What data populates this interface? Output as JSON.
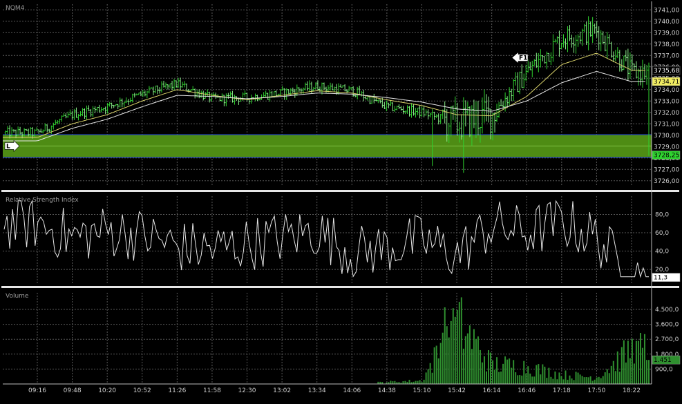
{
  "instrument": "NQM4",
  "price_pane": {
    "ylim": [
      3725.5,
      3741.5
    ],
    "y_ticks": [
      "3741,00",
      "3740,00",
      "3739,00",
      "3738,00",
      "3737,00",
      "3736,00",
      "3735,00",
      "3734,00",
      "3733,00",
      "3732,00",
      "3731,00",
      "3730,00",
      "3729,00",
      "3728,00",
      "3727,00",
      "3726,00"
    ],
    "zone": {
      "low": 3728.05,
      "high": 3730.05,
      "color": "#4e8c14"
    },
    "ma_fast_last": "3735,68",
    "ma_slow_last": "3734,71",
    "last_price": "3728,25",
    "markers": [
      {
        "label": "L",
        "side": "long"
      },
      {
        "label": "F1",
        "side": "short"
      }
    ]
  },
  "rsi_pane": {
    "title": "Relative Strength Index",
    "ylim": [
      5,
      100
    ],
    "y_ticks": [
      "80,0",
      "60,0",
      "40,0",
      "20,0"
    ],
    "last": "11,3"
  },
  "volume_pane": {
    "title": "Volume",
    "ylim": [
      0,
      5500
    ],
    "y_ticks": [
      "4.500,0",
      "3.600,0",
      "2.700,0",
      "1.800,0",
      "900,0"
    ],
    "last": "1.451"
  },
  "x_ticks": [
    "09:16",
    "09:48",
    "10:20",
    "10:52",
    "11:26",
    "11:58",
    "12:30",
    "13:02",
    "13:34",
    "14:06",
    "14:38",
    "15:10",
    "15:42",
    "16:14",
    "16:46",
    "17:18",
    "17:50",
    "18:22"
  ],
  "colors": {
    "bar": "#2fd22f",
    "bar_light": "#8ef08e",
    "ma_fast": "#d9d26a",
    "ma_slow": "#e8e8e8",
    "grid": "#5a5a5a",
    "volume": "#2f8f2f",
    "zone": "#4e8c14",
    "zone_border": "#1f3fbf"
  },
  "chart_data": [
    {
      "type": "bar",
      "title": "NQM4",
      "ylim": [
        3725.5,
        3741.5
      ],
      "x": [
        "09:16",
        "09:48",
        "10:20",
        "10:52",
        "11:26",
        "11:58",
        "12:30",
        "13:02",
        "13:34",
        "14:06",
        "14:38",
        "15:10",
        "15:42",
        "16:14",
        "16:46",
        "17:18",
        "17:50",
        "18:22"
      ],
      "series": [
        {
          "values": [
            3730.2,
            3731.8,
            3732.5,
            3733.6,
            3734.5,
            3733.2,
            3733.3,
            3733.7,
            3734.3,
            3733.9,
            3732.5,
            3732.0,
            3731.0,
            3731.8,
            3735.5,
            3738.5,
            3739.2,
            3735.5
          ]
        },
        {
          "values": [
            3729.8,
            3731.0,
            3731.8,
            3733.0,
            3734.0,
            3733.5,
            3733.1,
            3733.5,
            3733.9,
            3733.7,
            3733.1,
            3732.6,
            3731.8,
            3731.7,
            3733.4,
            3736.2,
            3737.2,
            3735.7
          ]
        },
        {
          "values": [
            3729.5,
            3730.6,
            3731.4,
            3732.5,
            3733.5,
            3733.4,
            3733.2,
            3733.4,
            3733.7,
            3733.6,
            3733.3,
            3732.9,
            3732.3,
            3732.1,
            3733.0,
            3734.6,
            3735.6,
            3734.7
          ]
        }
      ]
    },
    {
      "type": "line",
      "title": "Relative Strength Index",
      "ylim": [
        5,
        100
      ],
      "x": [
        "09:16",
        "09:48",
        "10:20",
        "10:52",
        "11:26",
        "11:58",
        "12:30",
        "13:02",
        "13:34",
        "14:06",
        "14:38",
        "15:10",
        "15:42",
        "16:14",
        "16:46",
        "17:18",
        "17:50",
        "18:22"
      ],
      "series": [
        {
          "values": [
            70,
            55,
            62,
            58,
            45,
            42,
            48,
            55,
            62,
            38,
            44,
            52,
            36,
            68,
            60,
            72,
            55,
            11.3
          ]
        }
      ]
    },
    {
      "type": "bar",
      "title": "Volume",
      "ylim": [
        0,
        5500
      ],
      "x": [
        "09:16",
        "09:48",
        "10:20",
        "10:52",
        "11:26",
        "11:58",
        "12:30",
        "13:02",
        "13:34",
        "14:06",
        "14:38",
        "15:10",
        "15:42",
        "16:14",
        "16:46",
        "17:18",
        "17:50",
        "18:22"
      ],
      "series": [
        {
          "values": [
            0,
            0,
            0,
            0,
            0,
            0,
            0,
            0,
            0,
            0,
            150,
            250,
            4800,
            1500,
            1300,
            700,
            500,
            2600
          ]
        }
      ]
    }
  ]
}
